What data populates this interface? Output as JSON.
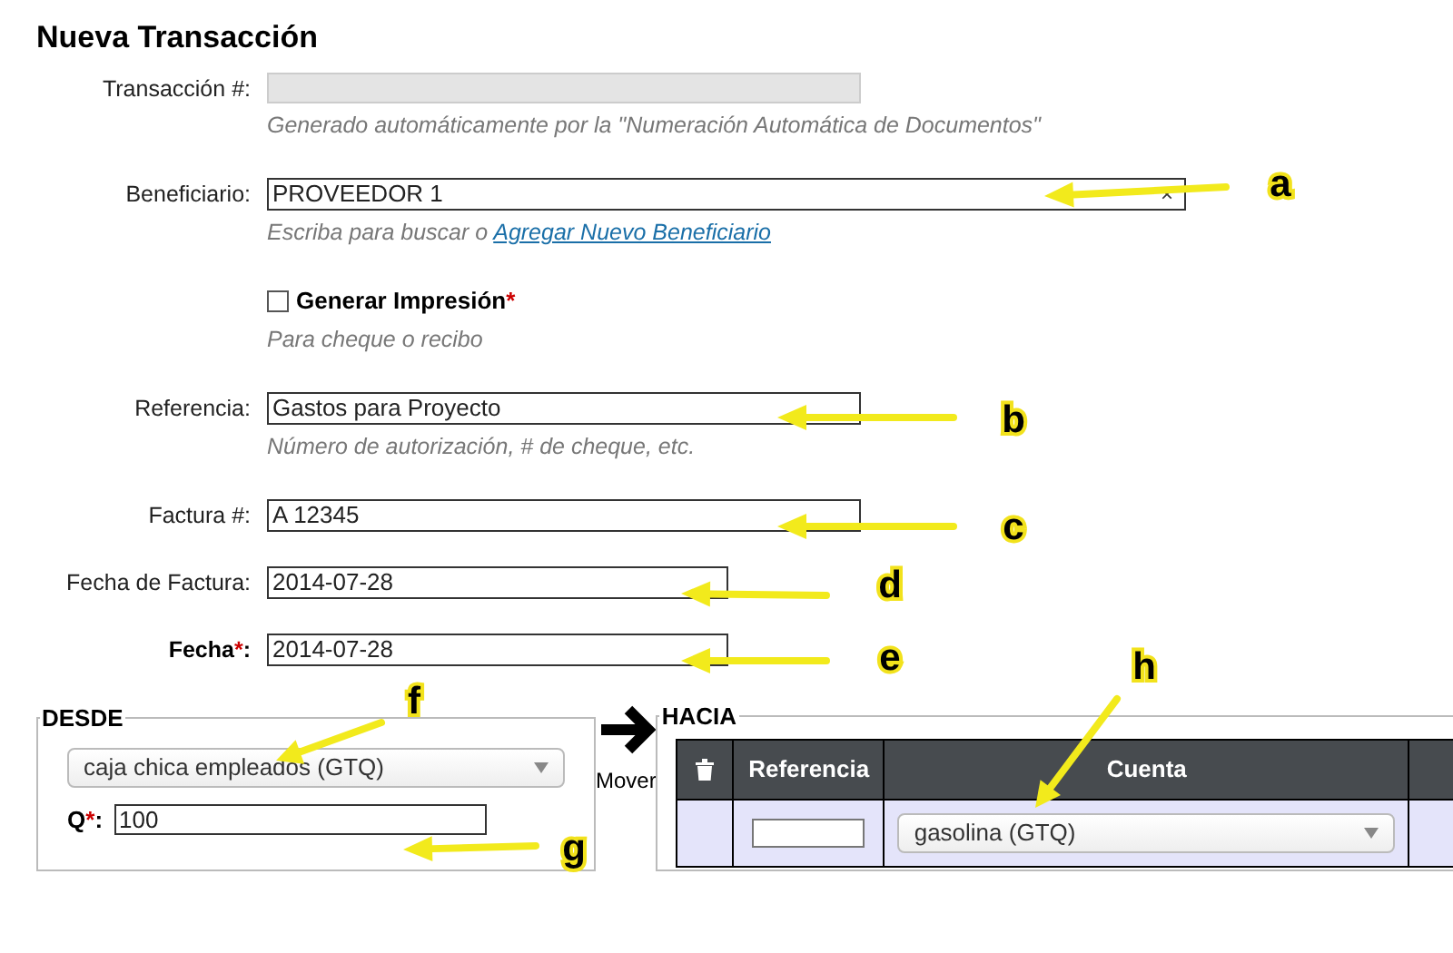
{
  "title": "Nueva Transacción",
  "fields": [
    {
      "kind": "readonly",
      "label": "Transacción #:",
      "hint": "Generado automáticamente por la \"Numeración Automática de Documentos\""
    },
    {
      "kind": "search",
      "label": "Beneficiario:",
      "value": "PROVEEDOR 1",
      "clear_icon": "×",
      "hint": "Escriba para buscar o ",
      "hint_link": "Agregar Nuevo Beneficiario"
    },
    {
      "kind": "checkbox",
      "label": "Generar Impresión",
      "required_mark": "*",
      "checked": false,
      "hint": "Para cheque o recibo"
    },
    {
      "kind": "text",
      "label": "Referencia:",
      "value": "Gastos para Proyecto",
      "hint": "Número de autorización, # de cheque, etc."
    },
    {
      "kind": "text",
      "label": "Factura #:",
      "value": "A 12345"
    },
    {
      "kind": "date",
      "label": "Fecha de Factura:",
      "value": "2014-07-28"
    },
    {
      "kind": "date",
      "label": "Fecha",
      "required_mark": "*",
      "label_suffix": ":",
      "value": "2014-07-28"
    }
  ],
  "desde": {
    "legend": "DESDE",
    "account": "caja chica empleados (GTQ)",
    "amount_label": "Q",
    "amount_required_mark": "*",
    "amount_suffix": ":",
    "amount": "100"
  },
  "move": {
    "label": "Mover"
  },
  "hacia": {
    "legend": "HACIA",
    "columns": [
      {
        "kind": "icon"
      },
      {
        "kind": "text",
        "label": "Referencia"
      },
      {
        "kind": "text",
        "label": "Cuenta"
      },
      {
        "kind": "empty"
      }
    ],
    "rows": [
      {
        "account": "gasolina (GTQ)"
      }
    ]
  },
  "annotations": [
    {
      "letter": "a",
      "kind": "left"
    },
    {
      "letter": "b",
      "kind": "left"
    },
    {
      "letter": "c",
      "kind": "left"
    },
    {
      "letter": "d",
      "kind": "left"
    },
    {
      "letter": "e",
      "kind": "left"
    },
    {
      "letter": "f",
      "kind": "down_left"
    },
    {
      "letter": "g",
      "kind": "left"
    },
    {
      "letter": "h",
      "kind": "down_left"
    }
  ]
}
